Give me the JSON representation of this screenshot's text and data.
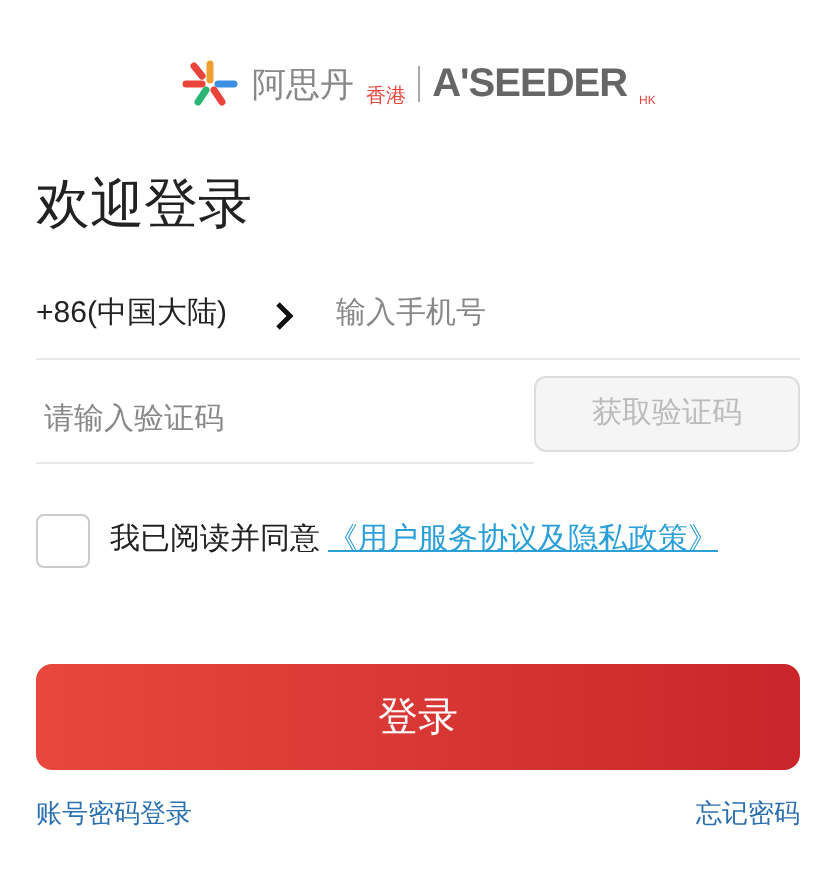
{
  "logo": {
    "cn": "阿思丹",
    "cn_sub": "香港",
    "en": "A'SEEDER",
    "en_sub": "HK"
  },
  "title": "欢迎登录",
  "phone": {
    "country": "+86(中国大陆)",
    "placeholder": "输入手机号"
  },
  "code": {
    "placeholder": "请输入验证码",
    "button": "获取验证码",
    "button_disabled": true
  },
  "agreement": {
    "checked": false,
    "text": "我已阅读并同意",
    "link": "《用户服务协议及隐私政策》"
  },
  "login_button": "登录",
  "links": [
    "账号密码登录",
    "忘记密码"
  ]
}
